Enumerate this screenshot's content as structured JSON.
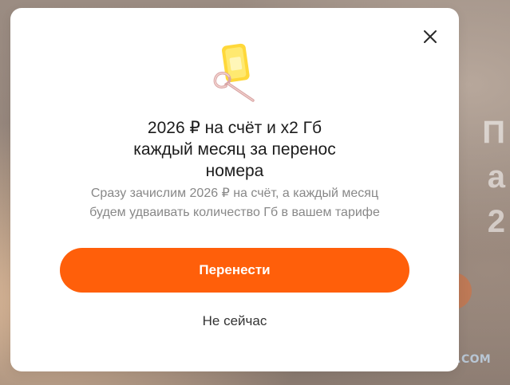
{
  "background": {
    "text_lines": [
      "П",
      "а",
      "2"
    ],
    "watermark": "YAPLAKAL.COM"
  },
  "modal": {
    "close_icon": "close-icon",
    "illustration_icon": "sim-card-eject-pin-icon",
    "title_lines": [
      "2026 ₽ на счёт и x2 Гб",
      "каждый месяц за перенос",
      "номера"
    ],
    "subtitle_lines": [
      "Сразу зачислим 2026 ₽ на счёт, а каждый месяц",
      "будем удваивать количество Гб в вашем тарифе"
    ],
    "primary_button_label": "Перенести",
    "secondary_button_label": "Не сейчас"
  },
  "colors": {
    "accent": "#ff5f0a",
    "title": "#1b1b1b",
    "subtitle": "#888888",
    "sim_yellow": "#ffe04a"
  }
}
